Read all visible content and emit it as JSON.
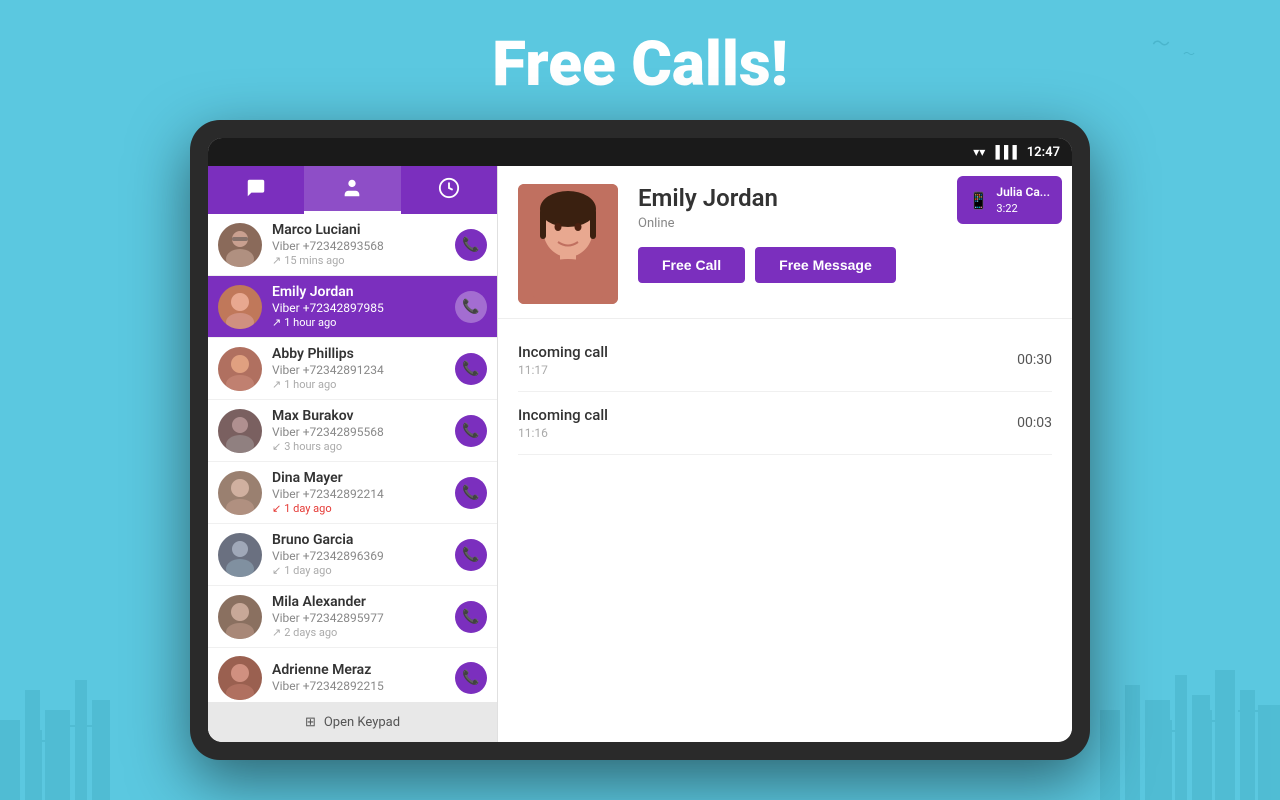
{
  "page": {
    "title": "Free Calls!",
    "bg_color": "#5bc8e0"
  },
  "status_bar": {
    "time": "12:47",
    "wifi_icon": "wifi",
    "signal_icon": "signal",
    "battery_icon": "battery"
  },
  "tabs": [
    {
      "id": "chat",
      "icon": "💬",
      "active": false
    },
    {
      "id": "contacts",
      "icon": "👤",
      "active": true
    },
    {
      "id": "recent",
      "icon": "🕐",
      "active": false
    }
  ],
  "contacts": [
    {
      "name": "Marco Luciani",
      "number": "Viber +72342893568",
      "time": "15 mins ago",
      "time_icon": "↗",
      "active": false,
      "missed": false
    },
    {
      "name": "Emily Jordan",
      "number": "Viber +72342897985",
      "time": "1 hour ago",
      "time_icon": "↗",
      "active": true,
      "missed": false
    },
    {
      "name": "Abby Phillips",
      "number": "Viber +72342891234",
      "time": "1 hour ago",
      "time_icon": "↗",
      "active": false,
      "missed": false
    },
    {
      "name": "Max Burakov",
      "number": "Viber +72342895568",
      "time": "3 hours ago",
      "time_icon": "↙",
      "active": false,
      "missed": false
    },
    {
      "name": "Dina Mayer",
      "number": "Viber +72342892214",
      "time": "1 day ago",
      "time_icon": "↙",
      "active": false,
      "missed": true
    },
    {
      "name": "Bruno Garcia",
      "number": "Viber +72342896369",
      "time": "1 day ago",
      "time_icon": "↙",
      "active": false,
      "missed": false
    },
    {
      "name": "Mila Alexander",
      "number": "Viber +72342895977",
      "time": "2 days ago",
      "time_icon": "↗",
      "active": false,
      "missed": false
    },
    {
      "name": "Adrienne Meraz",
      "number": "Viber +72342892215",
      "time": "",
      "time_icon": "",
      "active": false,
      "missed": false
    }
  ],
  "selected_contact": {
    "name": "Emily Jordan",
    "status": "Online",
    "call_btn": "Free Call",
    "message_btn": "Free Message"
  },
  "incoming_popup": {
    "name": "Julia Ca...",
    "time": "3:22"
  },
  "call_log": [
    {
      "type": "Incoming call",
      "time": "11:17",
      "duration": "00:30"
    },
    {
      "type": "Incoming call",
      "time": "11:16",
      "duration": "00:03"
    }
  ],
  "keypad": {
    "label": "Open Keypad"
  },
  "avatar_colors": [
    "#8a6a5a",
    "#c0785a",
    "#b07060",
    "#7a6060",
    "#9a8070",
    "#6a7080",
    "#8a7060",
    "#9a6050"
  ]
}
